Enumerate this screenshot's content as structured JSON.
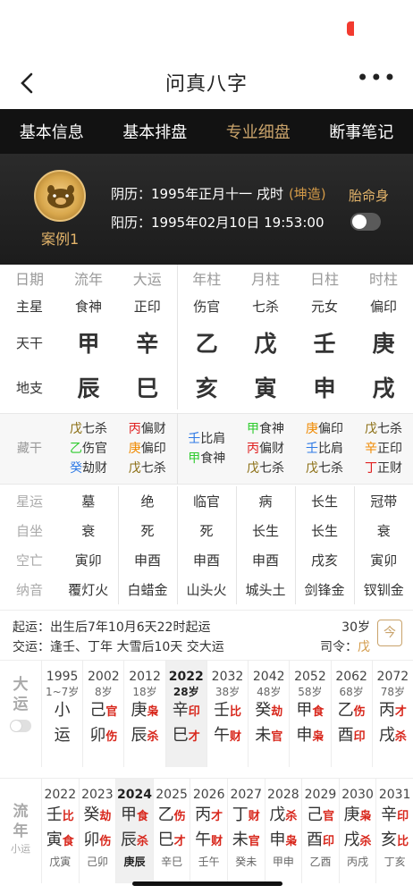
{
  "header": {
    "title": "问真八字",
    "more_label": "•••"
  },
  "tabs": [
    {
      "label": "基本信息"
    },
    {
      "label": "基本排盘"
    },
    {
      "label": "专业细盘"
    },
    {
      "label": "断事笔记"
    }
  ],
  "profile": {
    "case_name": "案例1",
    "lunar": "阴历：1995年正月十一 戌时",
    "lunar_tag": "(坤造)",
    "solar": "阳历：1995年02月10日 19:53:00",
    "taiyuan_label": "胎命身"
  },
  "pillars": {
    "headers": [
      "日期",
      "流年",
      "大运",
      "年柱",
      "月柱",
      "日柱",
      "时柱"
    ],
    "zhuxing": {
      "label": "主星",
      "values": [
        "食神",
        "正印",
        "伤官",
        "七杀",
        "元女",
        "偏印"
      ]
    },
    "tiangan": {
      "label": "天干",
      "values": [
        "甲",
        "辛",
        "乙",
        "戊",
        "壬",
        "庚"
      ]
    },
    "dizhi": {
      "label": "地支",
      "values": [
        "辰",
        "巳",
        "亥",
        "寅",
        "申",
        "戌"
      ]
    },
    "canggan": {
      "label": "藏干",
      "cols": [
        [
          [
            "戊",
            "七杀"
          ],
          [
            "乙",
            "伤官"
          ],
          [
            "癸",
            "劫财"
          ]
        ],
        [
          [
            "丙",
            "偏财"
          ],
          [
            "庚",
            "偏印"
          ],
          [
            "戊",
            "七杀"
          ]
        ],
        [
          [
            "壬",
            "比肩"
          ],
          [
            "甲",
            "食神"
          ]
        ],
        [
          [
            "甲",
            "食神"
          ],
          [
            "丙",
            "偏财"
          ],
          [
            "戊",
            "七杀"
          ]
        ],
        [
          [
            "庚",
            "偏印"
          ],
          [
            "壬",
            "比肩"
          ],
          [
            "戊",
            "七杀"
          ]
        ],
        [
          [
            "戊",
            "七杀"
          ],
          [
            "辛",
            "正印"
          ],
          [
            "丁",
            "正财"
          ]
        ]
      ]
    },
    "xingyun": {
      "label": "星运",
      "values": [
        "墓",
        "绝",
        "临官",
        "病",
        "长生",
        "冠带"
      ]
    },
    "zizuo": {
      "label": "自坐",
      "values": [
        "衰",
        "死",
        "死",
        "长生",
        "长生",
        "衰"
      ]
    },
    "kongwang": {
      "label": "空亡",
      "values": [
        "寅卯",
        "申酉",
        "申酉",
        "申酉",
        "戌亥",
        "寅卯"
      ]
    },
    "nayin": {
      "label": "纳音",
      "values": [
        "覆灯火",
        "白蜡金",
        "山头火",
        "城头土",
        "剑锋金",
        "钗钏金"
      ]
    }
  },
  "qiyun": {
    "line1": "起运：出生后7年10月6天22时起运",
    "line2": "交运：逢壬、丁年 大雪后10天 交大运",
    "age": "30岁",
    "siling_label": "司令：",
    "siling_value": "戊",
    "jin_label": "今"
  },
  "dayun": {
    "label": [
      "大",
      "运"
    ],
    "sub": [
      "小",
      "运"
    ],
    "items": [
      {
        "year": "1995",
        "age": "1~7岁",
        "g": "小",
        "gs": "",
        "z": "运",
        "zs": ""
      },
      {
        "year": "2002",
        "age": "8岁",
        "g": "己",
        "gs": "官",
        "z": "卯",
        "zs": "伤"
      },
      {
        "year": "2012",
        "age": "18岁",
        "g": "庚",
        "gs": "枭",
        "z": "辰",
        "zs": "杀"
      },
      {
        "year": "2022",
        "age": "28岁",
        "g": "辛",
        "gs": "印",
        "z": "巳",
        "zs": "才"
      },
      {
        "year": "2032",
        "age": "38岁",
        "g": "壬",
        "gs": "比",
        "z": "午",
        "zs": "财"
      },
      {
        "year": "2042",
        "age": "48岁",
        "g": "癸",
        "gs": "劫",
        "z": "未",
        "zs": "官"
      },
      {
        "year": "2052",
        "age": "58岁",
        "g": "甲",
        "gs": "食",
        "z": "申",
        "zs": "枭"
      },
      {
        "year": "2062",
        "age": "68岁",
        "g": "乙",
        "gs": "伤",
        "z": "酉",
        "zs": "印"
      },
      {
        "year": "2072",
        "age": "78岁",
        "g": "丙",
        "gs": "才",
        "z": "戌",
        "zs": "杀"
      }
    ]
  },
  "liunian": {
    "label": [
      "流",
      "年"
    ],
    "sub": "小运",
    "items": [
      {
        "year": "2022",
        "g": "壬",
        "gs": "比",
        "z": "寅",
        "zs": "食",
        "xy": "戊寅"
      },
      {
        "year": "2023",
        "g": "癸",
        "gs": "劫",
        "z": "卯",
        "zs": "伤",
        "xy": "己卯"
      },
      {
        "year": "2024",
        "g": "甲",
        "gs": "食",
        "z": "辰",
        "zs": "杀",
        "xy": "庚辰"
      },
      {
        "year": "2025",
        "g": "乙",
        "gs": "伤",
        "z": "巳",
        "zs": "才",
        "xy": "辛巳"
      },
      {
        "year": "2026",
        "g": "丙",
        "gs": "才",
        "z": "午",
        "zs": "财",
        "xy": "壬午"
      },
      {
        "year": "2027",
        "g": "丁",
        "gs": "财",
        "z": "未",
        "zs": "官",
        "xy": "癸未"
      },
      {
        "year": "2028",
        "g": "戊",
        "gs": "杀",
        "z": "申",
        "zs": "枭",
        "xy": "甲申"
      },
      {
        "year": "2029",
        "g": "己",
        "gs": "官",
        "z": "酉",
        "zs": "印",
        "xy": "乙酉"
      },
      {
        "year": "2030",
        "g": "庚",
        "gs": "枭",
        "z": "戌",
        "zs": "杀",
        "xy": "丙戌"
      },
      {
        "year": "2031",
        "g": "辛",
        "gs": "印",
        "z": "亥",
        "zs": "比",
        "xy": "丁亥"
      }
    ]
  },
  "colors": {
    "wood": "#2ecb2e",
    "fire": "#e02020",
    "earth": "#8a6d12",
    "metal": "#f08a00",
    "water": "#2f7ae5",
    "accent": "#c9a36b"
  }
}
